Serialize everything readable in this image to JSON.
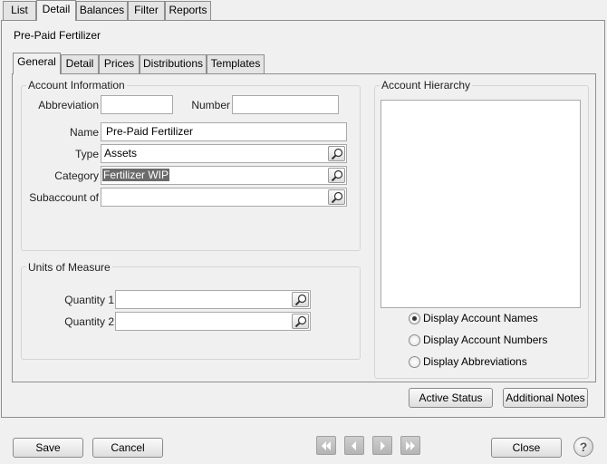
{
  "top_tabs": [
    "List",
    "Detail",
    "Balances",
    "Filter",
    "Reports"
  ],
  "record_title": "Pre-Paid Fertilizer",
  "sub_tabs": [
    "General",
    "Detail",
    "Prices",
    "Distributions",
    "Templates"
  ],
  "account_info": {
    "title": "Account Information",
    "abbreviation_label": "Abbreviation",
    "abbreviation_value": "",
    "number_label": "Number",
    "number_value": "",
    "name_label": "Name",
    "name_value": "Pre-Paid Fertilizer",
    "type_label": "Type",
    "type_value": "Assets",
    "category_label": "Category",
    "category_value": "Fertilizer WIP",
    "subaccount_label": "Subaccount of",
    "subaccount_value": ""
  },
  "units": {
    "title": "Units of Measure",
    "qty1_label": "Quantity 1",
    "qty1_value": "",
    "qty2_label": "Quantity 2",
    "qty2_value": ""
  },
  "hierarchy": {
    "title": "Account Hierarchy",
    "options": [
      {
        "label": "Display Account Names",
        "checked": true
      },
      {
        "label": "Display Account Numbers",
        "checked": false
      },
      {
        "label": "Display Abbreviations",
        "checked": false
      }
    ]
  },
  "buttons": {
    "active_status": "Active Status",
    "additional_notes": "Additional Notes",
    "save": "Save",
    "cancel": "Cancel",
    "close": "Close",
    "help": "?"
  },
  "icons": {
    "lookup": "magnifier-icon",
    "first": "first-record-icon",
    "prev": "previous-record-icon",
    "next": "next-record-icon",
    "last": "last-record-icon"
  }
}
